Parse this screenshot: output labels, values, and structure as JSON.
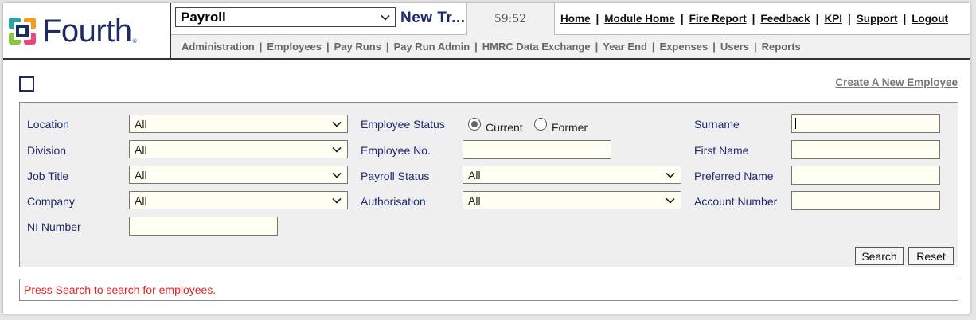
{
  "app": {
    "brand": "Fourth",
    "module_selected": "Payroll",
    "module_title": "New Tr...",
    "session_timer": "59:52"
  },
  "top_nav": [
    {
      "label": "Home"
    },
    {
      "label": "Module Home"
    },
    {
      "label": "Fire Report"
    },
    {
      "label": "Feedback"
    },
    {
      "label": "KPI"
    },
    {
      "label": "Support"
    },
    {
      "label": "Logout"
    }
  ],
  "sub_nav": [
    {
      "label": "Administration"
    },
    {
      "label": "Employees"
    },
    {
      "label": "Pay Runs"
    },
    {
      "label": "Pay Run Admin"
    },
    {
      "label": "HMRC Data Exchange"
    },
    {
      "label": "Year End"
    },
    {
      "label": "Expenses"
    },
    {
      "label": "Users"
    },
    {
      "label": "Reports"
    }
  ],
  "create_link": "Create A New Employee",
  "filters": {
    "location": {
      "label": "Location",
      "value": "All"
    },
    "division": {
      "label": "Division",
      "value": "All"
    },
    "job_title": {
      "label": "Job Title",
      "value": "All"
    },
    "company": {
      "label": "Company",
      "value": "All"
    },
    "ni_number": {
      "label": "NI Number",
      "value": ""
    },
    "employee_status": {
      "label": "Employee Status",
      "options": [
        "Current",
        "Former"
      ],
      "selected": "Current"
    },
    "employee_no": {
      "label": "Employee No.",
      "value": ""
    },
    "payroll_status": {
      "label": "Payroll Status",
      "value": "All"
    },
    "authorisation": {
      "label": "Authorisation",
      "value": "All"
    },
    "surname": {
      "label": "Surname",
      "value": ""
    },
    "first_name": {
      "label": "First Name",
      "value": ""
    },
    "preferred_name": {
      "label": "Preferred Name",
      "value": ""
    },
    "account_number": {
      "label": "Account Number",
      "value": ""
    }
  },
  "buttons": {
    "search": "Search",
    "reset": "Reset"
  },
  "status_message": "Press Search to search for employees.",
  "colors": {
    "brand_navy": "#1f2c5f",
    "label_navy": "#1c2a6e",
    "message_red": "#e8231d",
    "logo_teal": "#2aa6a0",
    "logo_orange": "#f39c1f",
    "logo_green": "#8cc63f",
    "logo_pink": "#e8457a"
  }
}
